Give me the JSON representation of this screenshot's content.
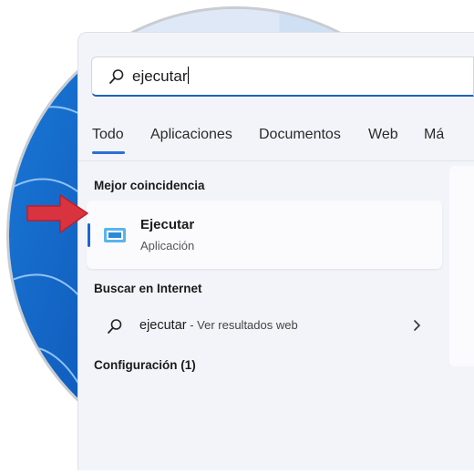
{
  "search": {
    "query": "ejecutar"
  },
  "tabs": [
    {
      "label": "Todo",
      "active": true
    },
    {
      "label": "Aplicaciones"
    },
    {
      "label": "Documentos"
    },
    {
      "label": "Web"
    },
    {
      "label": "Má"
    }
  ],
  "best_match": {
    "heading": "Mejor coincidencia",
    "name": "Ejecutar",
    "type": "Aplicación",
    "icon": "run-app-icon"
  },
  "internet": {
    "heading": "Buscar en Internet",
    "query": "ejecutar",
    "suffix": " - Ver resultados web"
  },
  "settings": {
    "heading": "Configuración (1)"
  },
  "colors": {
    "accent": "#1a64d6",
    "panel": "#f3f4f9",
    "pointer_arrow": "#d9333f"
  }
}
